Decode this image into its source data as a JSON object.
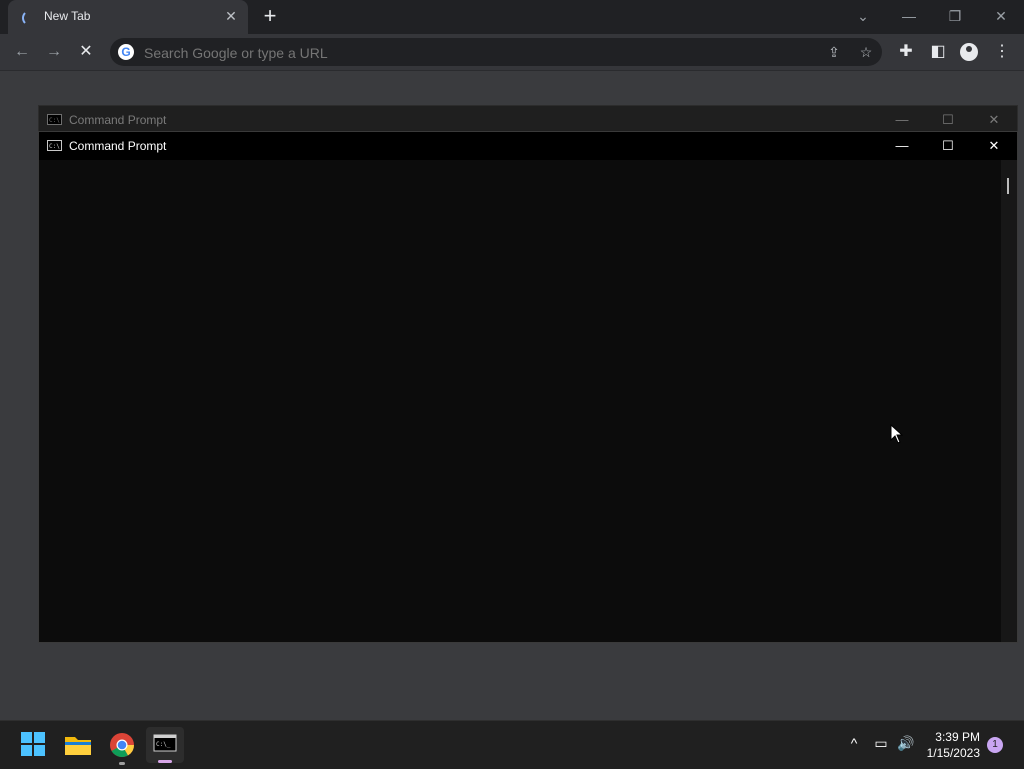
{
  "browser": {
    "tab_title": "New Tab",
    "tab_close": "✕",
    "new_tab": "+",
    "omnibox_placeholder": "Search Google or type a URL",
    "google_logo": "G",
    "window_controls": {
      "tabsearch": "⌄",
      "minimize": "—",
      "restore": "❐",
      "close": "✕"
    },
    "nav": {
      "back": "←",
      "forward": "→",
      "stop": "✕"
    },
    "toolbar_icons": {
      "share": "⇪",
      "bookmark": "☆",
      "extensions": "✚",
      "sidepanel": "◧",
      "menu": "⋮"
    }
  },
  "cmd_background": {
    "title": "Command Prompt",
    "icon_text": "C:\\"
  },
  "cmd_window": {
    "title": "Command Prompt",
    "icon_text": "C:\\",
    "controls": {
      "minimize": "—",
      "maximize": "☐",
      "close": "✕"
    }
  },
  "taskbar": {
    "tray": {
      "overflow": "^",
      "network": "▭",
      "volume": "🔊"
    },
    "time": "3:39 PM",
    "date": "1/15/2023",
    "notification_count": "1"
  },
  "colors": {
    "accent": "#4cc2ff",
    "chrome_dark": "#202124",
    "console_bg": "#0c0c0c"
  }
}
